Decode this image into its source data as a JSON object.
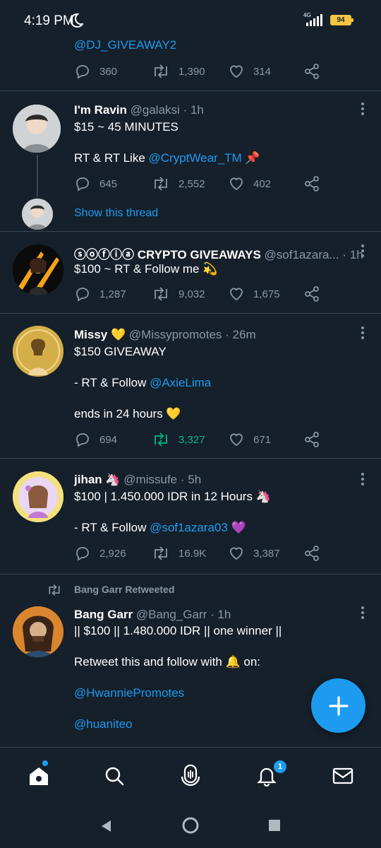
{
  "status": {
    "time": "4:19 PM",
    "network": "4G",
    "battery": "94"
  },
  "tweets": [
    {
      "text_lines": [
        ""
      ],
      "top_link": "@DJ_GIVEAWAY2",
      "replies": "360",
      "retweets": "1,390",
      "likes": "314"
    },
    {
      "name": "I'm Ravin",
      "handle": "@galaksi",
      "time": "· 1h",
      "line1": "$15 ~ 45 MINUTES",
      "line2_prefix": "RT & RT Like ",
      "line2_link": "@CryptWear_TM",
      "line2_suffix": " 📌",
      "replies": "645",
      "retweets": "2,552",
      "likes": "402",
      "show_thread": "Show this thread"
    },
    {
      "name": "ⓢⓞⓕⓘⓐ CRYPTO GIVEAWAYS",
      "handle": "@sof1azara...",
      "time": "· 1h",
      "line1": "$100 ~ RT & Follow me 💫",
      "replies": "1,287",
      "retweets": "9,032",
      "likes": "1,675"
    },
    {
      "name": "Missy 💛",
      "handle": "@Missypromotes",
      "time": "· 26m",
      "line1": "$150 GIVEAWAY",
      "line2_prefix": "- RT & Follow ",
      "line2_link": "@AxieLima",
      "line3": "ends in 24 hours 💛",
      "replies": "694",
      "retweets": "3,327",
      "likes": "671"
    },
    {
      "name": "jihan 🦄",
      "handle": "@missufe",
      "time": "· 5h",
      "line1": "$100 | 1.450.000 IDR in 12 Hours 🦄",
      "line2_prefix": "- RT & Follow ",
      "line2_link": "@sof1azara03",
      "line2_suffix": " 💜",
      "replies": "2,926",
      "retweets": "16.9K",
      "likes": "3,387"
    },
    {
      "retweeted_by": "Bang Garr Retweeted",
      "name": "Bang Garr",
      "handle": "@Bang_Garr",
      "time": "· 1h",
      "line1": "|| $100 || 1.480.000 IDR || one winner ||",
      "line2": "Retweet this and follow with 🔔 on:",
      "link1": "@HwanniePromotes",
      "link2": "@huaniteo"
    }
  ],
  "nav": {
    "notifications_badge": "1"
  },
  "colors": {
    "background": "#15202b",
    "accent": "#1d9bf0",
    "muted": "#8b98a5",
    "retweet_active": "#00ba7c"
  }
}
